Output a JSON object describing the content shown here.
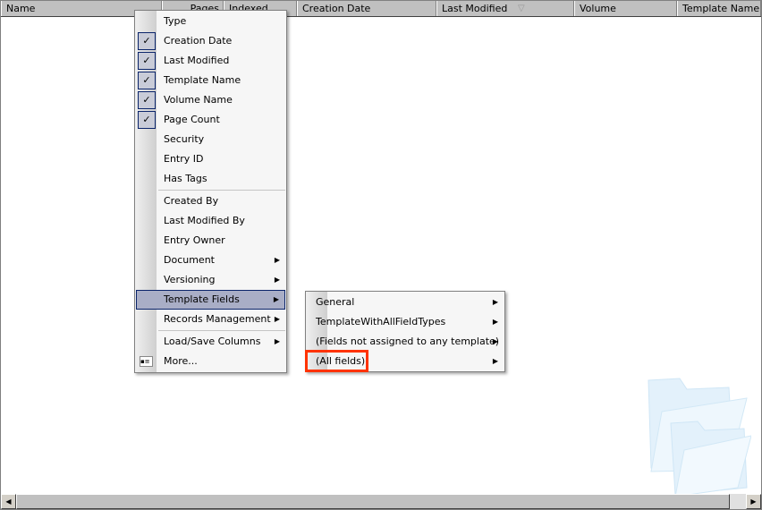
{
  "columns": [
    {
      "label": "Name"
    },
    {
      "label": "Pages"
    },
    {
      "label": "Indexed"
    },
    {
      "label": "Creation Date"
    },
    {
      "label": "Last Modified",
      "sort": "descending"
    },
    {
      "label": "Volume"
    },
    {
      "label": "Template Name"
    }
  ],
  "context_menu": {
    "items": [
      {
        "label": "Type",
        "checked": false
      },
      {
        "label": "Creation Date",
        "checked": true
      },
      {
        "label": "Last Modified",
        "checked": true
      },
      {
        "label": "Template Name",
        "checked": true
      },
      {
        "label": "Volume Name",
        "checked": true
      },
      {
        "label": "Page Count",
        "checked": true
      },
      {
        "label": "Security",
        "checked": false
      },
      {
        "label": "Entry ID",
        "checked": false
      },
      {
        "label": "Has Tags",
        "checked": false
      },
      {
        "label": "Created By"
      },
      {
        "label": "Last Modified By"
      },
      {
        "label": "Entry Owner"
      },
      {
        "label": "Document",
        "submenu": true
      },
      {
        "label": "Versioning",
        "submenu": true
      },
      {
        "label": "Template Fields",
        "submenu": true,
        "highlighted": true
      },
      {
        "label": "Records Management",
        "submenu": true
      },
      {
        "label": "Load/Save Columns",
        "submenu": true
      },
      {
        "label": "More...",
        "icon": "columns-dialog-icon"
      }
    ]
  },
  "submenu": {
    "items": [
      {
        "label": "General"
      },
      {
        "label": "TemplateWithAllFieldTypes"
      },
      {
        "label": "(Fields not assigned to any template)"
      },
      {
        "label": "(All fields)",
        "annotated": true
      }
    ],
    "annotation_color": "#ff3300"
  },
  "colors": {
    "highlight": "#a9aec6",
    "header": "#c0c0c0"
  }
}
